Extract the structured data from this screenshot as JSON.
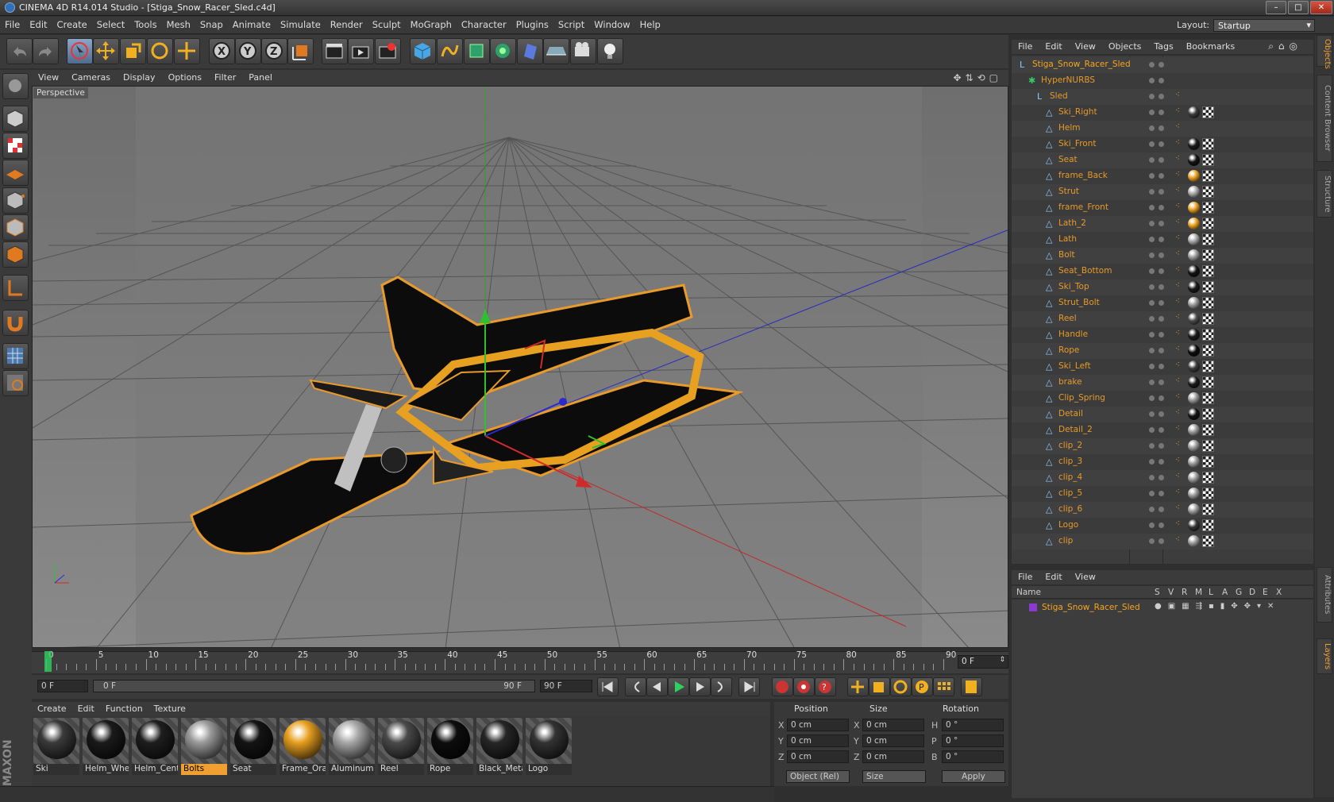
{
  "window": {
    "title": "CINEMA 4D R14.014 Studio - [Stiga_Snow_Racer_Sled.c4d]",
    "minimize": "–",
    "maximize": "□",
    "close": "✕"
  },
  "menubar": {
    "items": [
      "File",
      "Edit",
      "Create",
      "Select",
      "Tools",
      "Mesh",
      "Snap",
      "Animate",
      "Simulate",
      "Render",
      "Sculpt",
      "MoGraph",
      "Character",
      "Plugins",
      "Script",
      "Window",
      "Help"
    ],
    "layout_label": "Layout:",
    "layout_value": "Startup"
  },
  "viewport": {
    "menu": [
      "View",
      "Cameras",
      "Display",
      "Options",
      "Filter",
      "Panel"
    ],
    "label": "Perspective"
  },
  "timeline": {
    "ticks": [
      "0",
      "5",
      "10",
      "15",
      "20",
      "25",
      "30",
      "35",
      "40",
      "45",
      "50",
      "55",
      "60",
      "65",
      "70",
      "75",
      "80",
      "85",
      "90"
    ],
    "current_frame": "0 F",
    "start_field": "0 F",
    "range_start": "0 F",
    "range_end": "90 F",
    "end_field": "90 F"
  },
  "materials": {
    "menu": [
      "Create",
      "Edit",
      "Function",
      "Texture"
    ],
    "items": [
      {
        "name": "Ski",
        "color": "#3a3a3a",
        "selected": false
      },
      {
        "name": "Helm_Whe",
        "color": "#1a1a1a",
        "selected": false
      },
      {
        "name": "Helm_Cent",
        "color": "#1e1e1e",
        "selected": false
      },
      {
        "name": "Bolts",
        "color": "#9a9a9a",
        "selected": true
      },
      {
        "name": "Seat",
        "color": "#141414",
        "selected": false
      },
      {
        "name": "Frame_Ora",
        "color": "#e8a020",
        "selected": false
      },
      {
        "name": "Aluminum",
        "color": "#a8a8a8",
        "selected": false
      },
      {
        "name": "Reel",
        "color": "#4a4a4a",
        "selected": false
      },
      {
        "name": "Rope",
        "color": "#0d0d0d",
        "selected": false
      },
      {
        "name": "Black_Meta",
        "color": "#262626",
        "selected": false
      },
      {
        "name": "Logo",
        "color": "#333333",
        "selected": false
      }
    ]
  },
  "coordinates": {
    "headers": [
      "Position",
      "Size",
      "Rotation"
    ],
    "rows": [
      {
        "axis": "X",
        "pos": "0 cm",
        "size_axis": "X",
        "size": "0 cm",
        "rot_axis": "H",
        "rot": "0 °"
      },
      {
        "axis": "Y",
        "pos": "0 cm",
        "size_axis": "Y",
        "size": "0 cm",
        "rot_axis": "P",
        "rot": "0 °"
      },
      {
        "axis": "Z",
        "pos": "0 cm",
        "size_axis": "Z",
        "size": "0 cm",
        "rot_axis": "B",
        "rot": "0 °"
      }
    ],
    "mode": "Object (Rel)",
    "size_mode": "Size",
    "apply": "Apply"
  },
  "objects": {
    "menu": [
      "File",
      "Edit",
      "View",
      "Objects",
      "Tags",
      "Bookmarks"
    ],
    "tree": [
      {
        "name": "Stiga_Snow_Racer_Sled",
        "level": 0,
        "tag": "none"
      },
      {
        "name": "HyperNURBS",
        "level": 1,
        "tag": "none"
      },
      {
        "name": "Sled",
        "level": 2,
        "tag": "none"
      },
      {
        "name": "Ski_Right",
        "level": 3,
        "tag": "#3a3a3a"
      },
      {
        "name": "Helm",
        "level": 3,
        "tag": "none"
      },
      {
        "name": "Ski_Front",
        "level": 3,
        "tag": "#1a1a1a"
      },
      {
        "name": "Seat",
        "level": 3,
        "tag": "#141414"
      },
      {
        "name": "frame_Back",
        "level": 3,
        "tag": "#e8a020"
      },
      {
        "name": "Strut",
        "level": 3,
        "tag": "#a8a8a8"
      },
      {
        "name": "frame_Front",
        "level": 3,
        "tag": "#e8a020"
      },
      {
        "name": "Lath_2",
        "level": 3,
        "tag": "#e8a020"
      },
      {
        "name": "Lath",
        "level": 3,
        "tag": "#a8a8a8"
      },
      {
        "name": "Bolt",
        "level": 3,
        "tag": "#9a9a9a"
      },
      {
        "name": "Seat_Bottom",
        "level": 3,
        "tag": "#141414"
      },
      {
        "name": "Ski_Top",
        "level": 3,
        "tag": "#1a1a1a"
      },
      {
        "name": "Strut_Bolt",
        "level": 3,
        "tag": "#9a9a9a"
      },
      {
        "name": "Reel",
        "level": 3,
        "tag": "#4a4a4a"
      },
      {
        "name": "Handle",
        "level": 3,
        "tag": "#1a1a1a"
      },
      {
        "name": "Rope",
        "level": 3,
        "tag": "#0d0d0d"
      },
      {
        "name": "Ski_Left",
        "level": 3,
        "tag": "#3a3a3a"
      },
      {
        "name": "brake",
        "level": 3,
        "tag": "#1a1a1a"
      },
      {
        "name": "Clip_Spring",
        "level": 3,
        "tag": "#9a9a9a"
      },
      {
        "name": "Detail",
        "level": 3,
        "tag": "#141414"
      },
      {
        "name": "Detail_2",
        "level": 3,
        "tag": "#9a9a9a"
      },
      {
        "name": "clip_2",
        "level": 3,
        "tag": "#9a9a9a"
      },
      {
        "name": "clip_3",
        "level": 3,
        "tag": "#9a9a9a"
      },
      {
        "name": "clip_4",
        "level": 3,
        "tag": "#9a9a9a"
      },
      {
        "name": "clip_5",
        "level": 3,
        "tag": "#9a9a9a"
      },
      {
        "name": "clip_6",
        "level": 3,
        "tag": "#9a9a9a"
      },
      {
        "name": "Logo",
        "level": 3,
        "tag": "#333333"
      },
      {
        "name": "clip",
        "level": 3,
        "tag": "#9a9a9a"
      }
    ]
  },
  "layers": {
    "menu": [
      "File",
      "Edit",
      "View"
    ],
    "columns": [
      "Name",
      "S",
      "V",
      "R",
      "M",
      "L",
      "A",
      "G",
      "D",
      "E",
      "X"
    ],
    "items": [
      "Stiga_Snow_Racer_Sled"
    ]
  },
  "side_tabs": [
    "Objects",
    "Content Browser",
    "Structure",
    "Attributes",
    "Layers"
  ],
  "colors": {
    "accent": "#e59a2d",
    "selection": "#f0a030",
    "panel": "#3d3d3d"
  }
}
